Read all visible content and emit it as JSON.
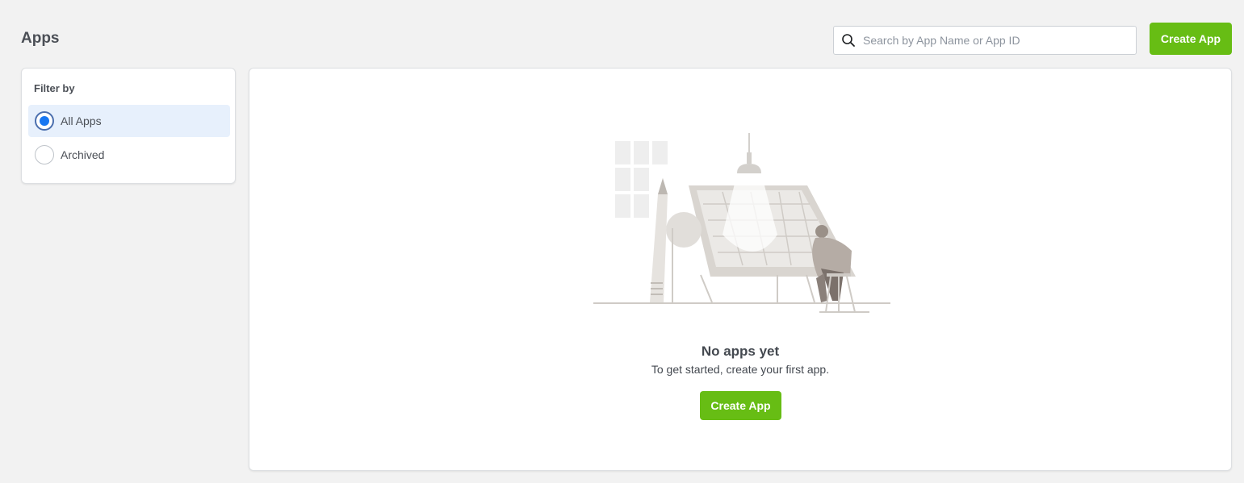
{
  "header": {
    "title": "Apps",
    "search_placeholder": "Search by App Name or App ID",
    "search_value": "",
    "create_label": "Create App"
  },
  "filter": {
    "title": "Filter by",
    "options": [
      {
        "label": "All Apps",
        "selected": true
      },
      {
        "label": "Archived",
        "selected": false
      }
    ]
  },
  "empty_state": {
    "title": "No apps yet",
    "subtitle": "To get started, create your first app.",
    "create_label": "Create App",
    "illustration_icon": "person-at-drafting-table-illustration"
  },
  "colors": {
    "accent_green": "#67bd14",
    "selected_bg": "#e7f0fc",
    "radio_blue": "#1877f2",
    "page_bg": "#f2f2f2"
  }
}
